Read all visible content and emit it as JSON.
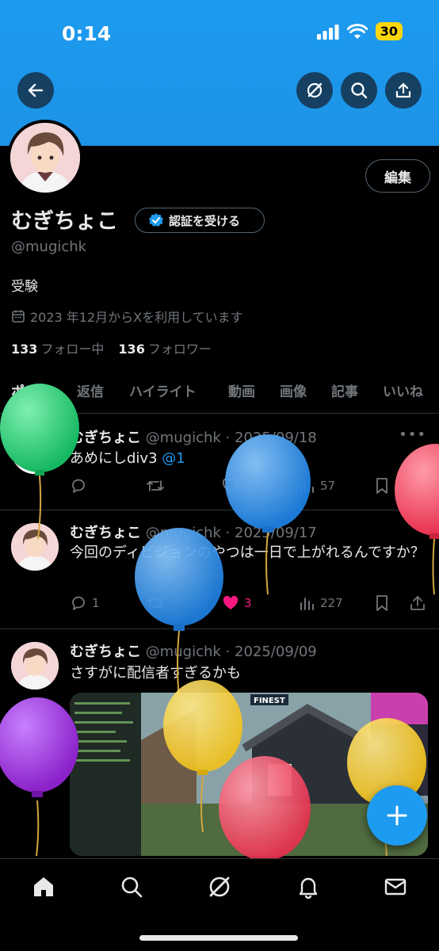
{
  "status_bar": {
    "time": "0:14",
    "battery": "30"
  },
  "profile": {
    "name": "むぎちょこ",
    "verify_label": "認証を受ける",
    "handle": "@mugichk",
    "bio": "受験",
    "joined": "2023 年12月からXを利用しています",
    "following_count": "133",
    "following_label": "フォロー中",
    "followers_count": "136",
    "followers_label": "フォロワー",
    "edit_label": "編集"
  },
  "tabs": [
    {
      "label": "ポスト"
    },
    {
      "label": "返信"
    },
    {
      "label": "ハイライト"
    },
    {
      "label": "動画"
    },
    {
      "label": "画像"
    },
    {
      "label": "記事"
    },
    {
      "label": "いいね"
    }
  ],
  "posts": [
    {
      "name": "むぎちょこ",
      "meta": "@mugichk · 2025/09/18",
      "text": "あめにしdiv3 ",
      "mention": "@1",
      "views": "57"
    },
    {
      "name": "むぎちょこ",
      "meta": "@mugichk · 2025/09/17",
      "text": "今回のディビジョンのやつは一日で上がれるんですか？",
      "replies": "1",
      "likes": "3",
      "views": "227"
    },
    {
      "name": "むぎちょこ",
      "meta": "@mugichk · 2025/09/09",
      "text": "さすがに配信者すぎるかも",
      "media_label": "FINEST"
    }
  ],
  "more_glyph": "•••",
  "colors": {
    "accent": "#1d9bf0",
    "like": "#f91880",
    "banner": "#1c9bf0"
  }
}
